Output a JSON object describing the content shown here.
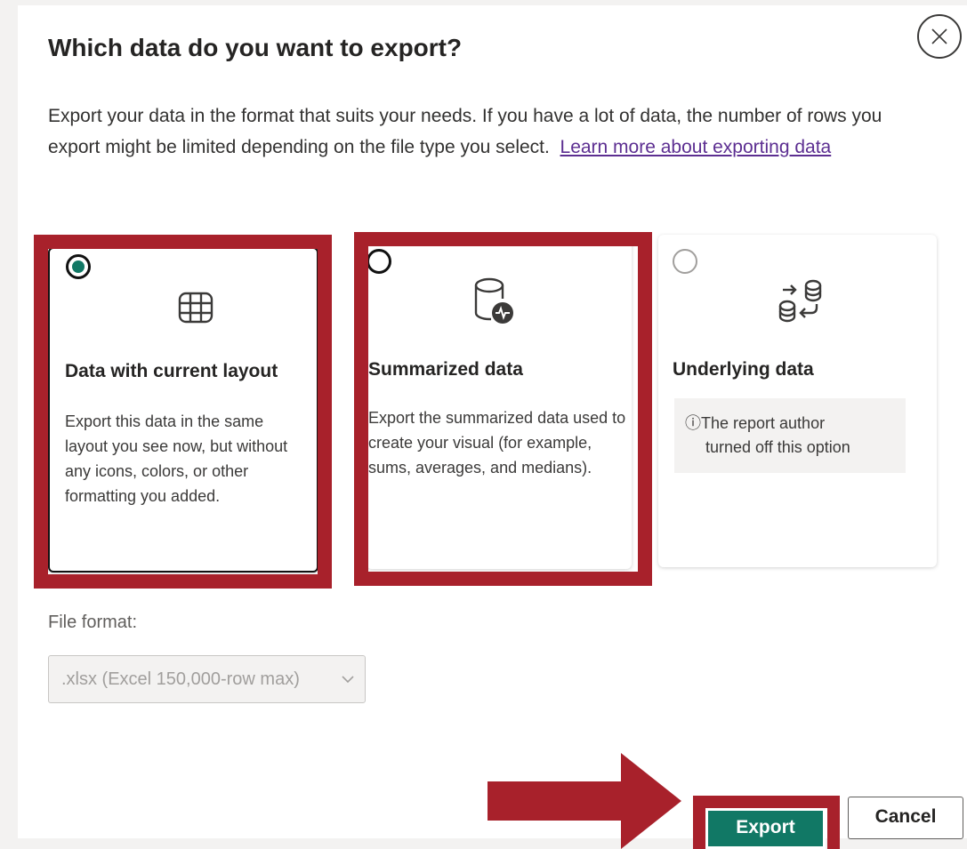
{
  "dialog": {
    "title": "Which data do you want to export?",
    "description": "Export your data in the format that suits your needs. If you have a lot of data, the number of rows you export might be limited depending on the file type you select.",
    "learn_more_link": "Learn more about exporting data"
  },
  "options": [
    {
      "title": "Data with current layout",
      "description": "Export this data in the same layout you see now, but without any icons, colors, or other formatting you added.",
      "selected": true,
      "icon": "table-grid-icon"
    },
    {
      "title": "Summarized data",
      "description": "Export the summarized data used to create your visual (for example, sums, averages, and medians).",
      "selected": false,
      "icon": "database-activity-icon"
    },
    {
      "title": "Underlying data",
      "info_line1": "ⓘThe report author",
      "info_line2": "turned off this option",
      "selected": false,
      "disabled": true,
      "icon": "database-transfer-icon"
    }
  ],
  "file_format": {
    "label": "File format:",
    "value": ".xlsx (Excel 150,000-row max)"
  },
  "buttons": {
    "export": "Export",
    "cancel": "Cancel"
  },
  "colors": {
    "accent": "#117865",
    "highlight": "#a8212b",
    "link": "#5c2e91"
  }
}
